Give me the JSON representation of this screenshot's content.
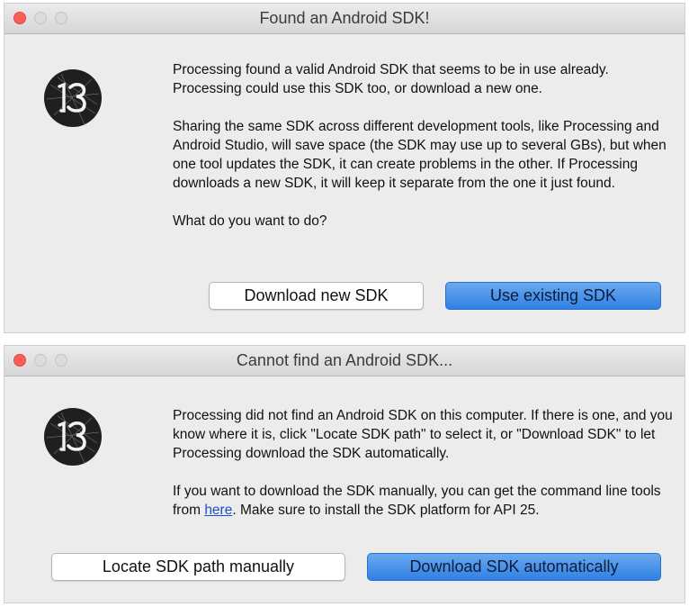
{
  "dialog1": {
    "title": "Found an Android SDK!",
    "paragraph1": "Processing found a valid Android SDK that seems to be in use already. Processing could use this SDK too, or download a new one.",
    "paragraph2": "Sharing the same SDK across different development tools, like Processing and Android Studio, will save space (the SDK may use up to several GBs), but when one tool updates the SDK, it can create problems in the other. If Processing downloads a new SDK, it will keep it separate from the one it just found.",
    "question": "What do you want to do?",
    "button_download_new": "Download new SDK",
    "button_use_existing": "Use existing SDK"
  },
  "dialog2": {
    "title": "Cannot find an Android SDK...",
    "paragraph1": "Processing did not find an Android SDK on this computer. If there is one, and you know where it is, click \"Locate SDK path\" to select it, or \"Download SDK\" to let Processing download the SDK automatically.",
    "paragraph2_before": "If you want to download the SDK manually, you can get the command line tools from ",
    "paragraph2_link": "here",
    "paragraph2_after": ". Make sure to install the SDK platform for API 25.",
    "button_locate": "Locate SDK path manually",
    "button_download_auto": "Download SDK automatically"
  },
  "logo": {
    "icon": "processing-logo-icon",
    "text": "P3"
  },
  "colors": {
    "primary_button": "#3b87e8",
    "close_dot": "#fd5f57",
    "link": "#1a4fd1"
  }
}
